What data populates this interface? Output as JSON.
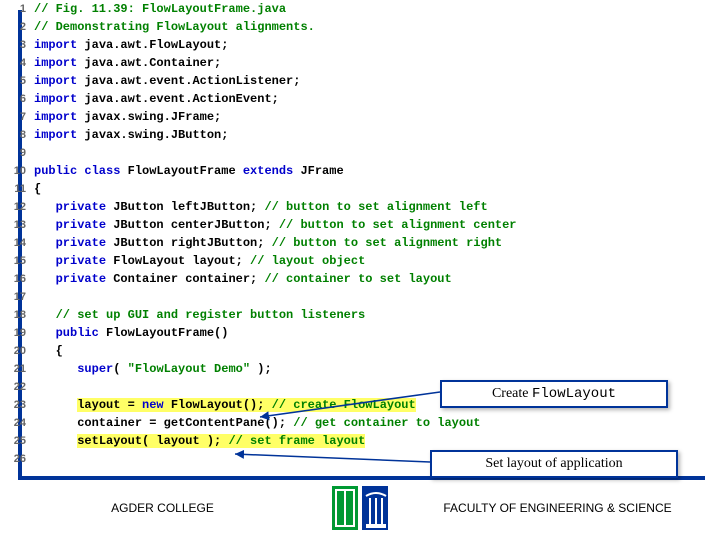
{
  "code": {
    "lines": [
      {
        "n": 1,
        "tokens": [
          {
            "t": "// Fig. 11.39: FlowLayoutFrame.java",
            "c": "comment"
          }
        ]
      },
      {
        "n": 2,
        "tokens": [
          {
            "t": "// Demonstrating FlowLayout alignments.",
            "c": "comment"
          }
        ]
      },
      {
        "n": 3,
        "tokens": [
          {
            "t": "import ",
            "c": "keyword"
          },
          {
            "t": "java.awt.FlowLayout;",
            "c": "plain"
          }
        ]
      },
      {
        "n": 4,
        "tokens": [
          {
            "t": "import ",
            "c": "keyword"
          },
          {
            "t": "java.awt.Container;",
            "c": "plain"
          }
        ]
      },
      {
        "n": 5,
        "tokens": [
          {
            "t": "import ",
            "c": "keyword"
          },
          {
            "t": "java.awt.event.ActionListener;",
            "c": "plain"
          }
        ]
      },
      {
        "n": 6,
        "tokens": [
          {
            "t": "import ",
            "c": "keyword"
          },
          {
            "t": "java.awt.event.ActionEvent;",
            "c": "plain"
          }
        ]
      },
      {
        "n": 7,
        "tokens": [
          {
            "t": "import ",
            "c": "keyword"
          },
          {
            "t": "javax.swing.JFrame;",
            "c": "plain"
          }
        ]
      },
      {
        "n": 8,
        "tokens": [
          {
            "t": "import ",
            "c": "keyword"
          },
          {
            "t": "javax.swing.JButton;",
            "c": "plain"
          }
        ]
      },
      {
        "n": 9,
        "tokens": []
      },
      {
        "n": 10,
        "tokens": [
          {
            "t": "public class ",
            "c": "keyword"
          },
          {
            "t": "FlowLayoutFrame ",
            "c": "plain"
          },
          {
            "t": "extends ",
            "c": "keyword"
          },
          {
            "t": "JFrame",
            "c": "plain"
          }
        ]
      },
      {
        "n": 11,
        "tokens": [
          {
            "t": "{",
            "c": "plain"
          }
        ]
      },
      {
        "n": 12,
        "tokens": [
          {
            "t": "   ",
            "c": "plain"
          },
          {
            "t": "private ",
            "c": "keyword"
          },
          {
            "t": "JButton leftJButton; ",
            "c": "plain"
          },
          {
            "t": "// button to set alignment left",
            "c": "comment"
          }
        ]
      },
      {
        "n": 13,
        "tokens": [
          {
            "t": "   ",
            "c": "plain"
          },
          {
            "t": "private ",
            "c": "keyword"
          },
          {
            "t": "JButton centerJButton; ",
            "c": "plain"
          },
          {
            "t": "// button to set alignment center",
            "c": "comment"
          }
        ]
      },
      {
        "n": 14,
        "tokens": [
          {
            "t": "   ",
            "c": "plain"
          },
          {
            "t": "private ",
            "c": "keyword"
          },
          {
            "t": "JButton rightJButton; ",
            "c": "plain"
          },
          {
            "t": "// button to set alignment right",
            "c": "comment"
          }
        ]
      },
      {
        "n": 15,
        "tokens": [
          {
            "t": "   ",
            "c": "plain"
          },
          {
            "t": "private ",
            "c": "keyword"
          },
          {
            "t": "FlowLayout layout; ",
            "c": "plain"
          },
          {
            "t": "// layout object",
            "c": "comment"
          }
        ]
      },
      {
        "n": 16,
        "tokens": [
          {
            "t": "   ",
            "c": "plain"
          },
          {
            "t": "private ",
            "c": "keyword"
          },
          {
            "t": "Container container; ",
            "c": "plain"
          },
          {
            "t": "// container to set layout",
            "c": "comment"
          }
        ]
      },
      {
        "n": 17,
        "tokens": []
      },
      {
        "n": 18,
        "tokens": [
          {
            "t": "   ",
            "c": "plain"
          },
          {
            "t": "// set up GUI and register button listeners",
            "c": "comment"
          }
        ]
      },
      {
        "n": 19,
        "tokens": [
          {
            "t": "   ",
            "c": "plain"
          },
          {
            "t": "public ",
            "c": "keyword"
          },
          {
            "t": "FlowLayoutFrame()",
            "c": "plain"
          }
        ]
      },
      {
        "n": 20,
        "tokens": [
          {
            "t": "   {",
            "c": "plain"
          }
        ]
      },
      {
        "n": 21,
        "tokens": [
          {
            "t": "      ",
            "c": "plain"
          },
          {
            "t": "super",
            "c": "keyword"
          },
          {
            "t": "( ",
            "c": "plain"
          },
          {
            "t": "\"FlowLayout Demo\"",
            "c": "string"
          },
          {
            "t": " );",
            "c": "plain"
          }
        ]
      },
      {
        "n": 22,
        "tokens": []
      },
      {
        "n": 23,
        "tokens": [
          {
            "t": "      ",
            "c": "plain"
          },
          {
            "t": "layout = ",
            "c": "plain",
            "hl": true
          },
          {
            "t": "new ",
            "c": "keyword",
            "hl": true
          },
          {
            "t": "FlowLayout(); ",
            "c": "plain",
            "hl": true
          },
          {
            "t": "// create FlowLayout",
            "c": "comment",
            "hl": true
          }
        ]
      },
      {
        "n": 24,
        "tokens": [
          {
            "t": "      container = getContentPane(); ",
            "c": "plain"
          },
          {
            "t": "// get container to layout",
            "c": "comment"
          }
        ]
      },
      {
        "n": 25,
        "tokens": [
          {
            "t": "      ",
            "c": "plain"
          },
          {
            "t": "setLayout( layout ); ",
            "c": "plain",
            "hl": true
          },
          {
            "t": "// set frame layout",
            "c": "comment",
            "hl": true
          }
        ]
      },
      {
        "n": 26,
        "tokens": []
      }
    ]
  },
  "callouts": {
    "create": {
      "prefix": "Create ",
      "mono": "FlowLayout"
    },
    "setlayout": "Set layout of application"
  },
  "footer": {
    "left": "AGDER COLLEGE",
    "right": "FACULTY OF ENGINEERING & SCIENCE"
  }
}
